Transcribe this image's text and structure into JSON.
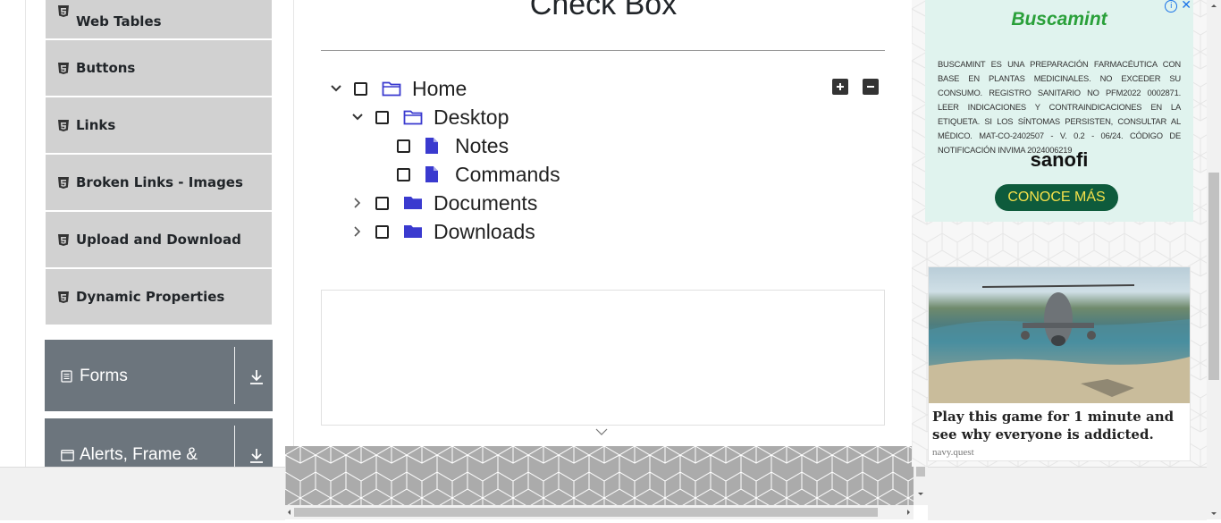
{
  "sidebar": {
    "items": [
      {
        "label": "Web Tables"
      },
      {
        "label": "Buttons"
      },
      {
        "label": "Links"
      },
      {
        "label": "Broken Links - Images"
      },
      {
        "label": "Upload and Download"
      },
      {
        "label": "Dynamic Properties"
      }
    ],
    "groups": [
      {
        "label": "Forms"
      },
      {
        "label": "Alerts, Frame &"
      }
    ]
  },
  "main": {
    "title": "Check Box",
    "tree": [
      {
        "label": "Home",
        "expanded": true,
        "checked": false,
        "icon": "folder-open-icon"
      },
      {
        "label": "Desktop",
        "expanded": true,
        "checked": false,
        "icon": "folder-open-icon"
      },
      {
        "label": "Notes",
        "checked": false,
        "icon": "file-icon"
      },
      {
        "label": "Commands",
        "checked": false,
        "icon": "file-icon"
      },
      {
        "label": "Documents",
        "expanded": false,
        "checked": false,
        "icon": "folder-icon"
      },
      {
        "label": "Downloads",
        "expanded": false,
        "checked": false,
        "icon": "folder-icon"
      }
    ],
    "expand_all": "expand-all-icon",
    "collapse_all": "collapse-all-icon"
  },
  "ads": {
    "ad1": {
      "brand": "Buscamint",
      "legal": "BUSCAMINT ES UNA PREPARACIÓN FARMACÉUTICA CON BASE EN PLANTAS MEDICINALES. NO EXCEDER SU CONSUMO. REGISTRO SANITARIO NO PFM2022 0002871. LEER INDICACIONES Y CONTRAINDICACIONES EN LA ETIQUETA. SI LOS SÍNTOMAS PERSISTEN, CONSULTAR AL MÉDICO. MAT-CO-2402507 - V. 0.2 - 06/24. CÓDIGO DE NOTIFICACIÓN INVIMA 2024006219",
      "company": "sanofi",
      "cta": "CONOCE MÁS"
    },
    "ad2": {
      "headline": "Play this game for 1 minute and see why everyone is addicted.",
      "source": "navy.quest"
    }
  },
  "colors": {
    "nav_item_bg": "#d1d1d1",
    "group_bg": "#6c757d",
    "icon_blue": "#3a3acf",
    "ad_green": "#0e5b3c"
  }
}
